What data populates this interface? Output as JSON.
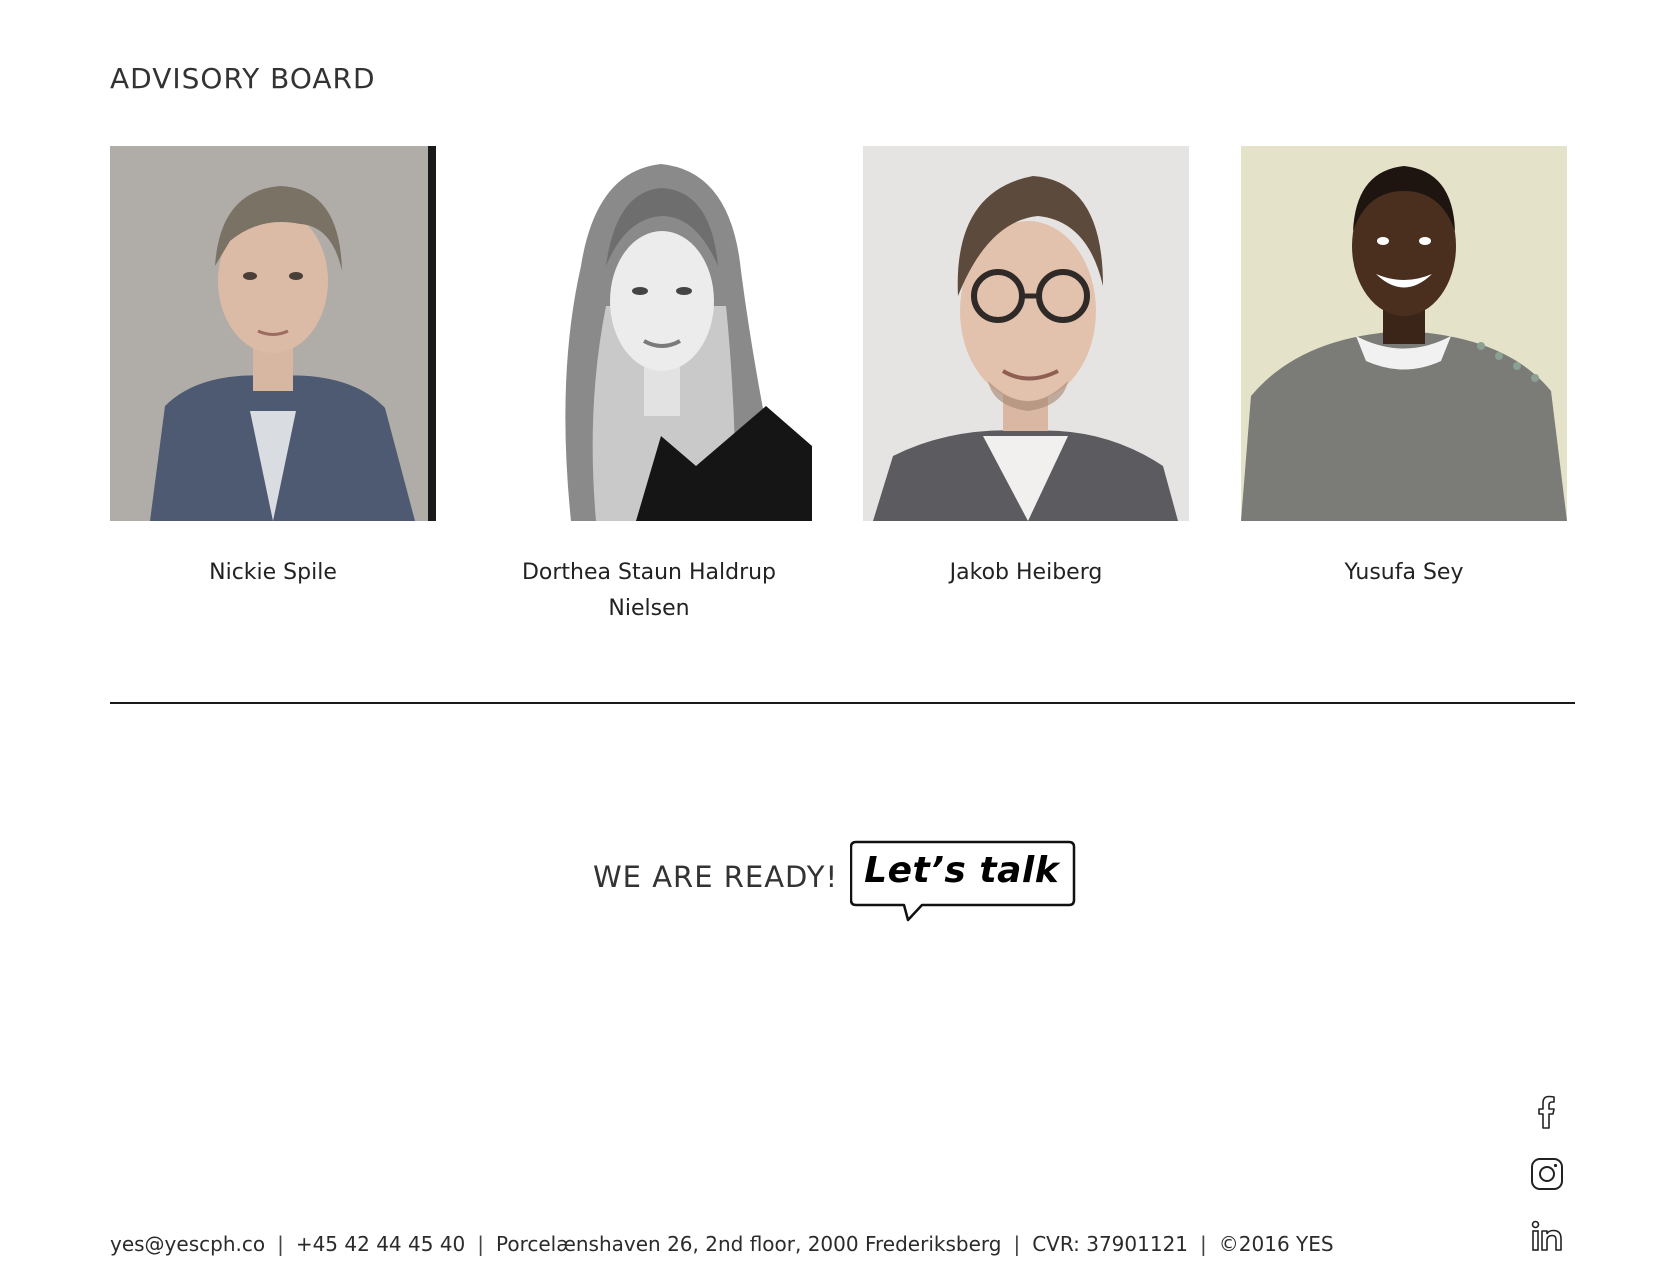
{
  "board": {
    "title": "ADVISORY BOARD",
    "members": [
      {
        "name": "Nickie Spile"
      },
      {
        "name": "Dorthea Staun Haldrup Nielsen"
      },
      {
        "name": "Jakob Heiberg"
      },
      {
        "name": "Yusufa Sey"
      }
    ]
  },
  "cta": {
    "ready": "WE ARE READY!",
    "talk": "Let’s talk"
  },
  "footer": {
    "email": "yes@yescph.co",
    "phone": "+45 42 44 45 40",
    "address": "Porcelænshaven 26, 2nd floor, 2000 Frederiksberg",
    "cvr": "CVR: 37901121",
    "copyright": "©2016 YES",
    "separator": "|"
  },
  "social": {
    "icons": [
      "facebook-icon",
      "instagram-icon",
      "linkedin-icon"
    ]
  }
}
